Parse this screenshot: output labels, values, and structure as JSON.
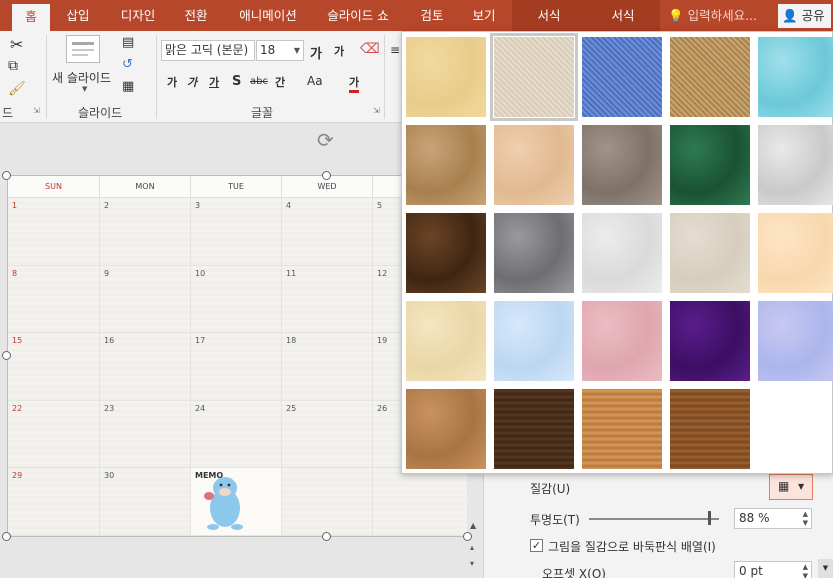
{
  "ribbon": {
    "tabs": [
      {
        "label": "홈",
        "active": true
      },
      {
        "label": "삽입"
      },
      {
        "label": "디자인"
      },
      {
        "label": "전환"
      },
      {
        "label": "애니메이션"
      },
      {
        "label": "슬라이드 쇼"
      },
      {
        "label": "검토"
      },
      {
        "label": "보기"
      },
      {
        "label": "서식",
        "contextual": true
      },
      {
        "label": "서식",
        "contextual": true
      }
    ],
    "search_placeholder": "입력하세요...",
    "share_label": "공유",
    "groups": {
      "clipboard_label": "드",
      "slides_label": "슬라이드",
      "font_label": "글꼴"
    },
    "new_slide_label": "새 슬라이드",
    "font_name": "맑은 고딕 (본문)",
    "font_size": "18",
    "font_buttons": [
      "가",
      "가",
      "가",
      "S",
      "abc",
      "간",
      "Aa",
      "가"
    ],
    "grow_shrink": [
      "가",
      "가"
    ]
  },
  "calendar": {
    "days": [
      "SUN",
      "MON",
      "TUE",
      "WED",
      ""
    ],
    "weeks": [
      [
        "1",
        "2",
        "3",
        "4",
        "5"
      ],
      [
        "8",
        "9",
        "10",
        "11",
        "12"
      ],
      [
        "15",
        "16",
        "17",
        "18",
        "19"
      ],
      [
        "22",
        "23",
        "24",
        "25",
        "26"
      ],
      [
        "29",
        "30",
        "MEMO",
        "",
        ""
      ]
    ]
  },
  "format_pane": {
    "texture_label": "질감(U)",
    "transparency_label": "투명도(T)",
    "transparency_value": "88 %",
    "transparency": 0.88,
    "tile_label": "그림을 질감으로 바둑판식 배열(I)",
    "tile_checked": true,
    "offset_x_label": "오프셋 X(O)",
    "offset_x_value": "0 pt"
  },
  "textures": [
    {
      "name": "papyrus",
      "c1": "#f0d9a0",
      "c2": "#e8cc8a"
    },
    {
      "name": "canvas",
      "c1": "#e6dccb",
      "c2": "#d8ccb8",
      "selected": true
    },
    {
      "name": "denim",
      "c1": "#6d8fd6",
      "c2": "#4d6fbf"
    },
    {
      "name": "woven-mat",
      "c1": "#c9a56e",
      "c2": "#a98450"
    },
    {
      "name": "water-droplets",
      "c1": "#9fe0ea",
      "c2": "#6cc8d8"
    },
    {
      "name": "paper-bag",
      "c1": "#c9a478",
      "c2": "#a8804f"
    },
    {
      "name": "fish-fossil",
      "c1": "#efcfae",
      "c2": "#e1b990"
    },
    {
      "name": "sand",
      "c1": "#a0948a",
      "c2": "#7d7168"
    },
    {
      "name": "green-marble",
      "c1": "#2f7a4f",
      "c2": "#1a5234"
    },
    {
      "name": "white-marble",
      "c1": "#e9e9e9",
      "c2": "#c9c9c9"
    },
    {
      "name": "brown-marble",
      "c1": "#6b4426",
      "c2": "#3f2612"
    },
    {
      "name": "granite",
      "c1": "#9a9a9e",
      "c2": "#6e6e72"
    },
    {
      "name": "newsprint",
      "c1": "#ececec",
      "c2": "#dadada"
    },
    {
      "name": "recycled-paper",
      "c1": "#e4ddd0",
      "c2": "#d6cdbd"
    },
    {
      "name": "parchment",
      "c1": "#fde6c4",
      "c2": "#f8d7ad"
    },
    {
      "name": "stationery",
      "c1": "#f5e6c0",
      "c2": "#ead6a6"
    },
    {
      "name": "blue-tissue-paper",
      "c1": "#d6e8fa",
      "c2": "#bcd6f2"
    },
    {
      "name": "pink-tissue-paper",
      "c1": "#ebbcc3",
      "c2": "#dfa6af"
    },
    {
      "name": "purple-mesh",
      "c1": "#5a1d8c",
      "c2": "#3b0f63"
    },
    {
      "name": "bouquet",
      "c1": "#c9c8f0",
      "c2": "#aab6ec"
    },
    {
      "name": "cork",
      "c1": "#c8935f",
      "c2": "#a97443"
    },
    {
      "name": "walnut",
      "c1": "#5a3a22",
      "c2": "#3d2413"
    },
    {
      "name": "oak",
      "c1": "#d89a5a",
      "c2": "#b8763a"
    },
    {
      "name": "medium-wood",
      "c1": "#9c6230",
      "c2": "#7a4620"
    }
  ]
}
